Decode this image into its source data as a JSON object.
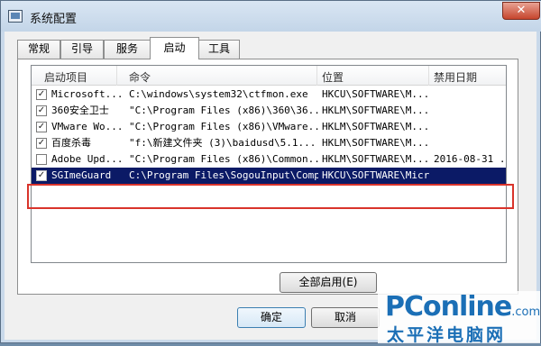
{
  "window": {
    "title": "系统配置",
    "close_glyph": "✕"
  },
  "tabs": [
    {
      "label": "常规"
    },
    {
      "label": "引导"
    },
    {
      "label": "服务"
    },
    {
      "label": "启动",
      "active": true
    },
    {
      "label": "工具"
    }
  ],
  "list": {
    "columns": {
      "item": "启动项目",
      "command": "命令",
      "location": "位置",
      "disabled_date": "禁用日期"
    },
    "rows": [
      {
        "checked": true,
        "item": "Microsoft...",
        "command": "C:\\windows\\system32\\ctfmon.exe",
        "location": "HKCU\\SOFTWARE\\M...",
        "date": ""
      },
      {
        "checked": true,
        "item": "360安全卫士",
        "command": "\"C:\\Program Files (x86)\\360\\36...",
        "location": "HKLM\\SOFTWARE\\M...",
        "date": ""
      },
      {
        "checked": true,
        "item": "VMware Wo...",
        "command": "\"C:\\Program Files (x86)\\VMware...",
        "location": "HKLM\\SOFTWARE\\M...",
        "date": ""
      },
      {
        "checked": true,
        "item": "百度杀毒",
        "command": "\"f:\\新建文件夹 (3)\\baidusd\\5.1...",
        "location": "HKLM\\SOFTWARE\\M...",
        "date": ""
      },
      {
        "checked": false,
        "item": "Adobe Upd...",
        "command": "\"C:\\Program Files (x86)\\Common...",
        "location": "HKLM\\SOFTWARE\\M...",
        "date": "2016-08-31 ..."
      },
      {
        "checked": true,
        "item": "SGImeGuard",
        "command": "C:\\Program Files\\SogouInput\\Comp...",
        "location": "HKCU\\SOFTWARE\\Micros",
        "date": "",
        "selected": true
      }
    ]
  },
  "buttons": {
    "enable_all": "全部启用(E)",
    "ok": "确定",
    "cancel": "取消"
  },
  "watermark": {
    "brand": "PConline",
    "domain": ".com.cn",
    "sub": "太平洋电脑网"
  },
  "colors": {
    "selection": "#0b1a66",
    "highlight_border": "#d9342b",
    "brand": "#1b6fb6"
  }
}
